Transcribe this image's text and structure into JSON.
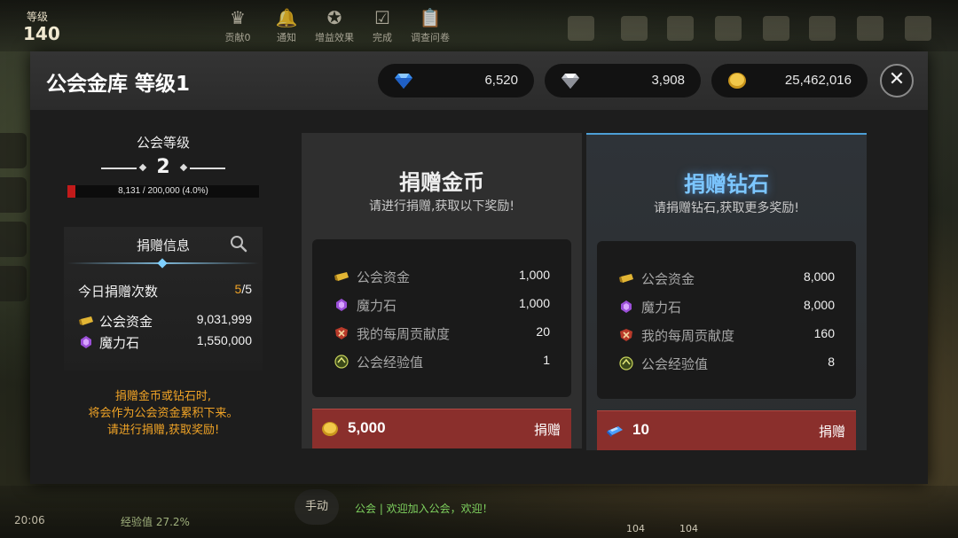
{
  "hud": {
    "level_label": "等级",
    "level_value": "140",
    "icons": [
      {
        "name": "contribution-icon",
        "label": "贡献0",
        "glyph": "♛"
      },
      {
        "name": "notification-icon",
        "label": "通知",
        "glyph": "🔔"
      },
      {
        "name": "buff-icon",
        "label": "增益效果",
        "glyph": "✪"
      },
      {
        "name": "complete-icon",
        "label": "完成",
        "glyph": "☑"
      },
      {
        "name": "survey-icon",
        "label": "调查问卷",
        "glyph": "📋"
      }
    ],
    "time": "20:06",
    "exp": "经验值 27.2%",
    "manual": "手动",
    "chat": "公会 | 欢迎加入公会，欢迎！",
    "bottom_nums": [
      "104",
      "104"
    ]
  },
  "panel": {
    "title": "公会金库 等级1",
    "currency": {
      "diamond": "6,520",
      "silver_diamond": "3,908",
      "gold": "25,462,016"
    },
    "close": "✕"
  },
  "guild": {
    "level_title": "公会等级",
    "level": "2",
    "xp_text": "8,131 / 200,000 (4.0%)",
    "xp_fraction": 0.04
  },
  "donation_info": {
    "title": "捐赠信息",
    "today_label": "今日捐赠次数",
    "today_used": "5",
    "today_total": "/5",
    "fund_label": "公会资金",
    "fund_value": "9,031,999",
    "stone_label": "魔力石",
    "stone_value": "1,550,000"
  },
  "note": [
    "捐赠金币或钻石时,",
    "将会作为公会资金累积下来。",
    "请进行捐赠,获取奖励!"
  ],
  "cards": [
    {
      "title": "捐赠金币",
      "subtitle": "请进行捐赠,获取以下奖励!",
      "rewards": [
        {
          "label": "公会资金",
          "value": "1,000"
        },
        {
          "label": "魔力石",
          "value": "1,000"
        },
        {
          "label": "我的每周贡献度",
          "value": "20"
        },
        {
          "label": "公会经验值",
          "value": "1"
        }
      ],
      "cost": "5,000",
      "button": "捐赠"
    },
    {
      "title": "捐赠钻石",
      "subtitle": "请捐赠钻石,获取更多奖励!",
      "rewards": [
        {
          "label": "公会资金",
          "value": "8,000"
        },
        {
          "label": "魔力石",
          "value": "8,000"
        },
        {
          "label": "我的每周贡献度",
          "value": "160"
        },
        {
          "label": "公会经验值",
          "value": "8"
        }
      ],
      "cost": "10",
      "button": "捐赠"
    }
  ],
  "colors": {
    "accent_orange": "#f0a326",
    "donate_red": "#8a2f2c",
    "selected_blue": "#7cc6ff",
    "xp_red": "#c21a1a"
  }
}
